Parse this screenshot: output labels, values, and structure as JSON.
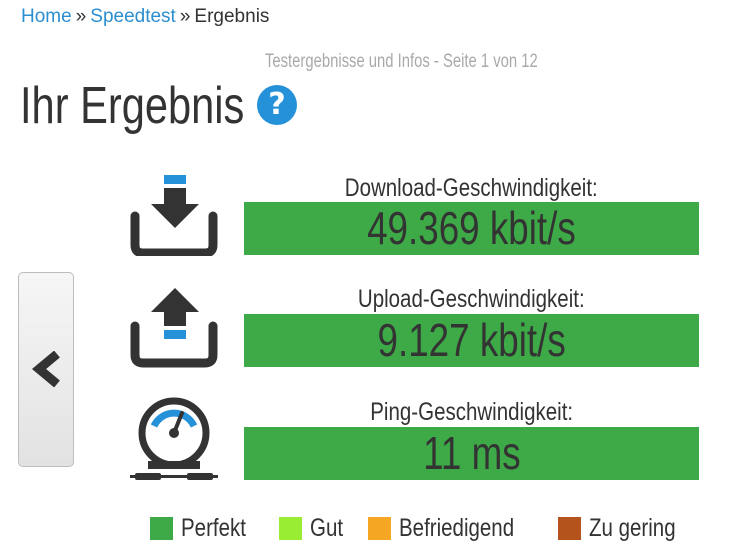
{
  "breadcrumb": {
    "home": "Home",
    "speedtest": "Speedtest",
    "current": "Ergebnis",
    "separator": "»"
  },
  "subtitle": "Testergebnisse und Infos - Seite 1 von 12",
  "title": "Ihr Ergebnis",
  "help_icon": "?",
  "metrics": [
    {
      "label": "Download-Geschwindigkeit:",
      "value": "49.369 kbit/s",
      "icon": "download-icon",
      "rating": "Perfekt"
    },
    {
      "label": "Upload-Geschwindigkeit:",
      "value": "9.127 kbit/s",
      "icon": "upload-icon",
      "rating": "Perfekt"
    },
    {
      "label": "Ping-Geschwindigkeit:",
      "value": "11 ms",
      "icon": "gauge-icon",
      "rating": "Perfekt"
    }
  ],
  "legend": [
    {
      "label": "Perfekt",
      "color": "#3eaa47"
    },
    {
      "label": "Gut",
      "color": "#99ee33"
    },
    {
      "label": "Befriedigend",
      "color": "#f5a623"
    },
    {
      "label": "Zu gering",
      "color": "#b5531c"
    }
  ],
  "colors": {
    "link": "#2b8fcf",
    "accent": "#2591d8",
    "icon_dark": "#333333"
  }
}
